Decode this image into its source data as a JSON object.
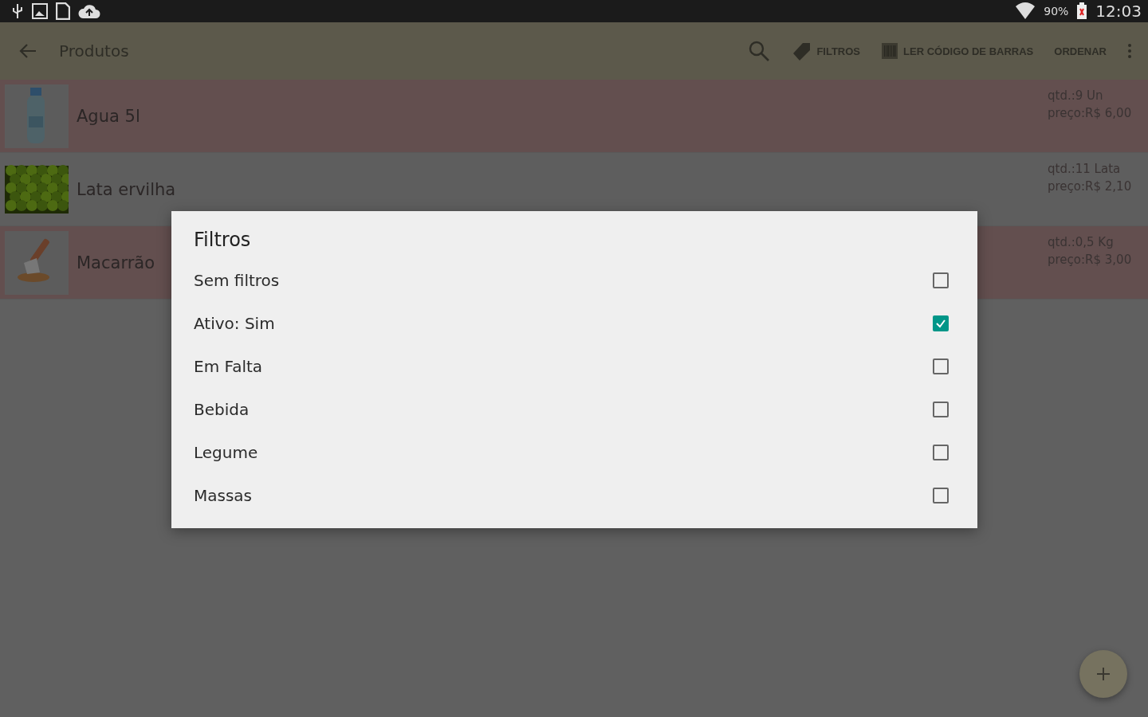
{
  "status_bar": {
    "battery": "90%",
    "time": "12:03"
  },
  "toolbar": {
    "title": "Produtos",
    "actions": [
      {
        "kind": "search"
      },
      {
        "kind": "filter",
        "label": "FILTROS"
      },
      {
        "kind": "barcode",
        "label": "LER CÓDIGO DE BARRAS"
      },
      {
        "kind": "text",
        "label": "ORDENAR"
      },
      {
        "kind": "more"
      }
    ]
  },
  "products": [
    {
      "name": "Agua 5l",
      "qty": "qtd.:9 Un",
      "price": "preço:R$ 6,00",
      "highlighted": true
    },
    {
      "name": "Lata ervilha",
      "qty": "qtd.:11 Lata",
      "price": "preço:R$ 2,10",
      "highlighted": false
    },
    {
      "name": "Macarrão",
      "qty": "qtd.:0,5 Kg",
      "price": "preço:R$ 3,00",
      "highlighted": true
    }
  ],
  "dialog": {
    "title": "Filtros",
    "options": [
      {
        "label": "Sem filtros",
        "checked": false
      },
      {
        "label": "Ativo: Sim",
        "checked": true
      },
      {
        "label": "Em Falta",
        "checked": false
      },
      {
        "label": "Bebida",
        "checked": false
      },
      {
        "label": "Legume",
        "checked": false
      },
      {
        "label": "Massas",
        "checked": false
      }
    ]
  }
}
